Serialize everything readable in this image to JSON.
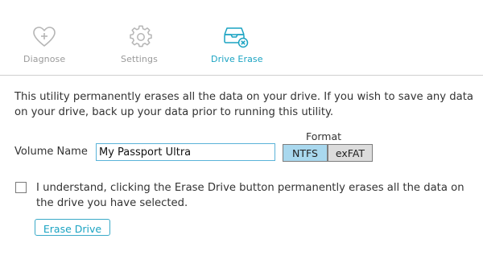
{
  "tabs": {
    "diagnose": {
      "label": "Diagnose",
      "icon": "heart-plus-icon"
    },
    "settings": {
      "label": "Settings",
      "icon": "gear-icon"
    },
    "drive_erase": {
      "label": "Drive Erase",
      "icon": "drive-erase-icon",
      "active": true
    }
  },
  "main": {
    "description": "This utility permanently erases all the data on your drive. If you wish to save any data on your drive, back up your data prior to running this utility.",
    "volume_name_label": "Volume Name",
    "volume_name_value": "My Passport Ultra",
    "format_label": "Format",
    "format_options": [
      "NTFS",
      "exFAT"
    ],
    "format_selected": "NTFS",
    "confirm_checked": false,
    "confirm_text": "I understand, clicking the Erase Drive button permanently erases all the data on the drive you have selected.",
    "erase_button_label": "Erase Drive"
  },
  "colors": {
    "accent": "#1aa3c2",
    "inactive_tab": "#9a9a9a",
    "selected_format_bg": "#a9d8ee",
    "unselected_format_bg": "#dcdcdc"
  }
}
